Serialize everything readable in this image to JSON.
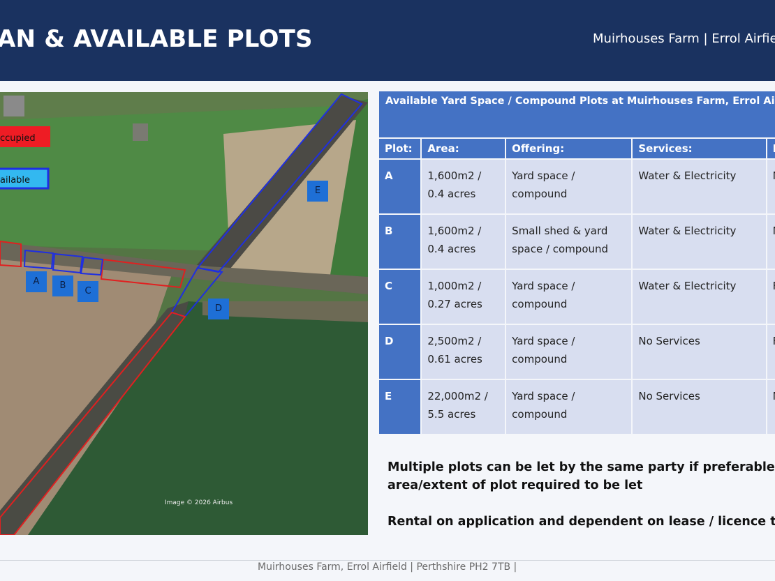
{
  "header": {
    "title": "AN & AVAILABLE PLOTS",
    "subtitle": "Muirhouses Farm  |  Errol Airfiel"
  },
  "map": {
    "legend_occupied": "ccupied",
    "legend_available": "ailable",
    "credit": "Image © 2026 Airbus",
    "plot_labels": [
      "A",
      "B",
      "C",
      "D",
      "E"
    ]
  },
  "table": {
    "title": "Available Yard Space / Compound Plots at Muirhouses Farm, Errol Airfiel",
    "headers": [
      "Plot:",
      "Area:",
      "Offering:",
      "Services:",
      "R"
    ],
    "rows": [
      {
        "plot": "A",
        "area_l1": "1,600m2 /",
        "area_l2": "0.4 acres",
        "offering_l1": "Yard space /",
        "offering_l2": "compound",
        "services": "Water & Electricity",
        "extra": "N"
      },
      {
        "plot": "B",
        "area_l1": "1,600m2 /",
        "area_l2": "0.4 acres",
        "offering_l1": "Small shed & yard",
        "offering_l2": "space / compound",
        "services": "Water & Electricity",
        "extra": "N"
      },
      {
        "plot": "C",
        "area_l1": "1,000m2 /",
        "area_l2": "0.27 acres",
        "offering_l1": "Yard space /",
        "offering_l2": "compound",
        "services": "Water & Electricity",
        "extra": "F"
      },
      {
        "plot": "D",
        "area_l1": "2,500m2 /",
        "area_l2": "0.61 acres",
        "offering_l1": "Yard space /",
        "offering_l2": "compound",
        "services": "No Services",
        "extra": "F"
      },
      {
        "plot": "E",
        "area_l1": "22,000m2 /",
        "area_l2": "5.5 acres",
        "offering_l1": "Yard space /",
        "offering_l2": "compound",
        "services": "No Services",
        "extra": "N"
      }
    ]
  },
  "notes": {
    "line1": "Multiple plots can be let by the same party if preferable and fl",
    "line2": "area/extent of plot required to be let",
    "line3": "Rental on application and dependent on lease / licence terms"
  },
  "footer": {
    "text": "Muirhouses Farm, Errol Airfield  |  Perthshire PH2 7TB  |"
  },
  "colors": {
    "header_bg": "#1a3260",
    "table_header": "#4472c4",
    "table_cell": "#d8def0",
    "occupied": "#e02020",
    "available": "#1f3fd6"
  }
}
